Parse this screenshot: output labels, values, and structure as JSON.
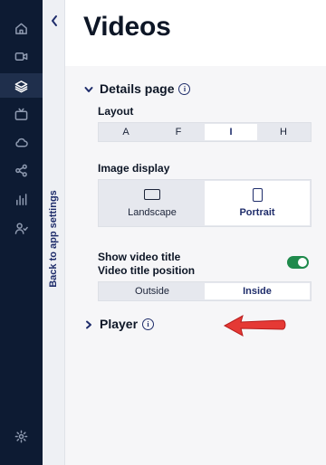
{
  "rail": {
    "items": [
      {
        "name": "home-icon"
      },
      {
        "name": "video-icon"
      },
      {
        "name": "layers-icon",
        "active": true
      },
      {
        "name": "tv-icon"
      },
      {
        "name": "cloud-icon"
      },
      {
        "name": "share-icon"
      },
      {
        "name": "bar-chart-icon"
      },
      {
        "name": "users-icon"
      },
      {
        "name": "gear-icon"
      }
    ]
  },
  "back": {
    "label": "Back to app settings"
  },
  "page": {
    "title": "Videos"
  },
  "details": {
    "label": "Details page",
    "layout": {
      "label": "Layout",
      "options": [
        "A",
        "F",
        "I",
        "H"
      ],
      "selected": "I"
    },
    "image_display": {
      "label": "Image display",
      "options": [
        "Landscape",
        "Portrait"
      ],
      "selected": "Portrait"
    },
    "show_title": {
      "label": "Show video title",
      "on": true
    },
    "title_position": {
      "label": "Video title position",
      "options": [
        "Outside",
        "Inside"
      ],
      "selected": "Inside"
    }
  },
  "player": {
    "label": "Player"
  },
  "colors": {
    "rail_bg": "#0d1b33",
    "accent": "#1f2d6b",
    "toggle_on": "#1f8a4c",
    "arrow": "#e53935"
  }
}
